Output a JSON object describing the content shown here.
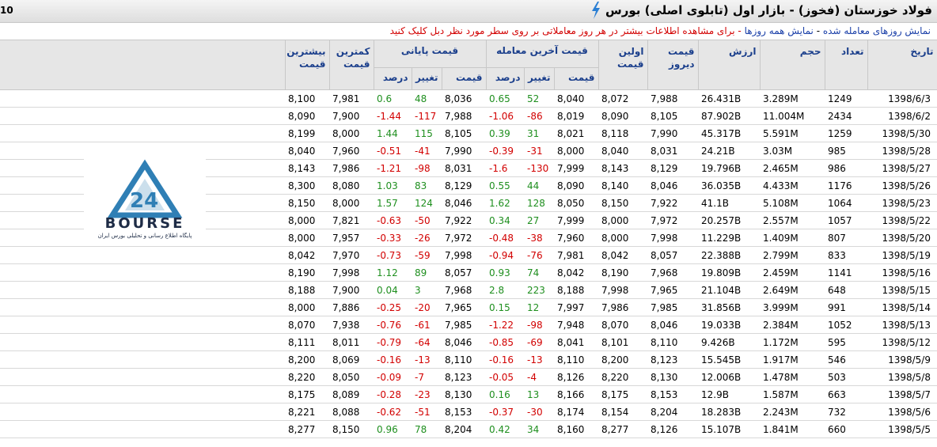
{
  "header": {
    "title": "فولاد خوزستان (فخوز) - بازار اول (تابلوی اصلی) بورس",
    "corner_text": "10"
  },
  "links": {
    "traded_days": "نمایش روزهای معامله شده",
    "separator": "-",
    "all_days": "نمایش همه روزها",
    "note": "- برای مشاهده اطلاعات بیشتر در هر روز معاملاتی بر روی سطر مورد نظر دبل کلیک کنید"
  },
  "logo": {
    "text": "BOURSE",
    "number": "24",
    "tagline": "پایگاه اطلاع رسانی و تحلیلی بورس ایران",
    "colors": {
      "accent": "#2f7fb5",
      "text": "#1e2c46"
    }
  },
  "colors": {
    "positive": "#1f8f1f",
    "negative": "#d20000",
    "header_text": "#1b3f8c"
  },
  "table": {
    "headers": {
      "date": "تاریخ",
      "count": "تعداد",
      "volume": "حجم",
      "value": "ارزش",
      "yesterday": "قیمت دیروز",
      "first": "اولین قیمت",
      "last_trade_group": "قیمت آخرین معامله",
      "final_group": "قیمت پایانی",
      "price": "قیمت",
      "change": "تغییر",
      "percent": "درصد",
      "low": "کمترین قیمت",
      "high": "بیشترین قیمت"
    },
    "rows": [
      {
        "date": "1398/6/3",
        "count": "1249",
        "volume": "3.289M",
        "value": "26.431B",
        "yesterday": "7,988",
        "first": "8,072",
        "last_price": "8,040",
        "last_change": "52",
        "last_pct": "0.65",
        "final_price": "8,036",
        "final_change": "48",
        "final_pct": "0.6",
        "low": "7,981",
        "high": "8,100"
      },
      {
        "date": "1398/6/2",
        "count": "2434",
        "volume": "11.004M",
        "value": "87.902B",
        "yesterday": "8,105",
        "first": "8,090",
        "last_price": "8,019",
        "last_change": "-86",
        "last_pct": "-1.06",
        "final_price": "7,988",
        "final_change": "-117",
        "final_pct": "-1.44",
        "low": "7,900",
        "high": "8,090"
      },
      {
        "date": "1398/5/30",
        "count": "1259",
        "volume": "5.591M",
        "value": "45.317B",
        "yesterday": "7,990",
        "first": "8,118",
        "last_price": "8,021",
        "last_change": "31",
        "last_pct": "0.39",
        "final_price": "8,105",
        "final_change": "115",
        "final_pct": "1.44",
        "low": "8,000",
        "high": "8,199"
      },
      {
        "date": "1398/5/28",
        "count": "985",
        "volume": "3.03M",
        "value": "24.21B",
        "yesterday": "8,031",
        "first": "8,040",
        "last_price": "8,000",
        "last_change": "-31",
        "last_pct": "-0.39",
        "final_price": "7,990",
        "final_change": "-41",
        "final_pct": "-0.51",
        "low": "7,960",
        "high": "8,040"
      },
      {
        "date": "1398/5/27",
        "count": "986",
        "volume": "2.465M",
        "value": "19.796B",
        "yesterday": "8,129",
        "first": "8,143",
        "last_price": "7,999",
        "last_change": "-130",
        "last_pct": "-1.6",
        "final_price": "8,031",
        "final_change": "-98",
        "final_pct": "-1.21",
        "low": "7,986",
        "high": "8,143"
      },
      {
        "date": "1398/5/26",
        "count": "1176",
        "volume": "4.433M",
        "value": "36.035B",
        "yesterday": "8,046",
        "first": "8,140",
        "last_price": "8,090",
        "last_change": "44",
        "last_pct": "0.55",
        "final_price": "8,129",
        "final_change": "83",
        "final_pct": "1.03",
        "low": "8,080",
        "high": "8,300"
      },
      {
        "date": "1398/5/23",
        "count": "1064",
        "volume": "5.108M",
        "value": "41.1B",
        "yesterday": "7,922",
        "first": "8,150",
        "last_price": "8,050",
        "last_change": "128",
        "last_pct": "1.62",
        "final_price": "8,046",
        "final_change": "124",
        "final_pct": "1.57",
        "low": "8,000",
        "high": "8,150"
      },
      {
        "date": "1398/5/22",
        "count": "1057",
        "volume": "2.557M",
        "value": "20.257B",
        "yesterday": "7,972",
        "first": "8,000",
        "last_price": "7,999",
        "last_change": "27",
        "last_pct": "0.34",
        "final_price": "7,922",
        "final_change": "-50",
        "final_pct": "-0.63",
        "low": "7,821",
        "high": "8,000"
      },
      {
        "date": "1398/5/20",
        "count": "807",
        "volume": "1.409M",
        "value": "11.229B",
        "yesterday": "7,998",
        "first": "8,000",
        "last_price": "7,960",
        "last_change": "-38",
        "last_pct": "-0.48",
        "final_price": "7,972",
        "final_change": "-26",
        "final_pct": "-0.33",
        "low": "7,957",
        "high": "8,000"
      },
      {
        "date": "1398/5/19",
        "count": "833",
        "volume": "2.799M",
        "value": "22.388B",
        "yesterday": "8,057",
        "first": "8,042",
        "last_price": "7,981",
        "last_change": "-76",
        "last_pct": "-0.94",
        "final_price": "7,998",
        "final_change": "-59",
        "final_pct": "-0.73",
        "low": "7,970",
        "high": "8,042"
      },
      {
        "date": "1398/5/16",
        "count": "1141",
        "volume": "2.459M",
        "value": "19.809B",
        "yesterday": "7,968",
        "first": "8,190",
        "last_price": "8,042",
        "last_change": "74",
        "last_pct": "0.93",
        "final_price": "8,057",
        "final_change": "89",
        "final_pct": "1.12",
        "low": "7,998",
        "high": "8,190"
      },
      {
        "date": "1398/5/15",
        "count": "648",
        "volume": "2.649M",
        "value": "21.104B",
        "yesterday": "7,965",
        "first": "7,998",
        "last_price": "8,188",
        "last_change": "223",
        "last_pct": "2.8",
        "final_price": "7,968",
        "final_change": "3",
        "final_pct": "0.04",
        "low": "7,900",
        "high": "8,188"
      },
      {
        "date": "1398/5/14",
        "count": "991",
        "volume": "3.999M",
        "value": "31.856B",
        "yesterday": "7,985",
        "first": "7,986",
        "last_price": "7,997",
        "last_change": "12",
        "last_pct": "0.15",
        "final_price": "7,965",
        "final_change": "-20",
        "final_pct": "-0.25",
        "low": "7,886",
        "high": "8,000"
      },
      {
        "date": "1398/5/13",
        "count": "1052",
        "volume": "2.384M",
        "value": "19.033B",
        "yesterday": "8,046",
        "first": "8,070",
        "last_price": "7,948",
        "last_change": "-98",
        "last_pct": "-1.22",
        "final_price": "7,985",
        "final_change": "-61",
        "final_pct": "-0.76",
        "low": "7,938",
        "high": "8,070"
      },
      {
        "date": "1398/5/12",
        "count": "595",
        "volume": "1.172M",
        "value": "9.426B",
        "yesterday": "8,110",
        "first": "8,101",
        "last_price": "8,041",
        "last_change": "-69",
        "last_pct": "-0.85",
        "final_price": "8,046",
        "final_change": "-64",
        "final_pct": "-0.79",
        "low": "8,011",
        "high": "8,111"
      },
      {
        "date": "1398/5/9",
        "count": "546",
        "volume": "1.917M",
        "value": "15.545B",
        "yesterday": "8,123",
        "first": "8,200",
        "last_price": "8,110",
        "last_change": "-13",
        "last_pct": "-0.16",
        "final_price": "8,110",
        "final_change": "-13",
        "final_pct": "-0.16",
        "low": "8,069",
        "high": "8,200"
      },
      {
        "date": "1398/5/8",
        "count": "503",
        "volume": "1.478M",
        "value": "12.006B",
        "yesterday": "8,130",
        "first": "8,220",
        "last_price": "8,126",
        "last_change": "-4",
        "last_pct": "-0.05",
        "final_price": "8,123",
        "final_change": "-7",
        "final_pct": "-0.09",
        "low": "8,050",
        "high": "8,220"
      },
      {
        "date": "1398/5/7",
        "count": "663",
        "volume": "1.587M",
        "value": "12.9B",
        "yesterday": "8,153",
        "first": "8,175",
        "last_price": "8,166",
        "last_change": "13",
        "last_pct": "0.16",
        "final_price": "8,130",
        "final_change": "-23",
        "final_pct": "-0.28",
        "low": "8,089",
        "high": "8,175"
      },
      {
        "date": "1398/5/6",
        "count": "732",
        "volume": "2.243M",
        "value": "18.283B",
        "yesterday": "8,204",
        "first": "8,154",
        "last_price": "8,174",
        "last_change": "-30",
        "last_pct": "-0.37",
        "final_price": "8,153",
        "final_change": "-51",
        "final_pct": "-0.62",
        "low": "8,088",
        "high": "8,221"
      },
      {
        "date": "1398/5/5",
        "count": "660",
        "volume": "1.841M",
        "value": "15.107B",
        "yesterday": "8,126",
        "first": "8,277",
        "last_price": "8,160",
        "last_change": "34",
        "last_pct": "0.42",
        "final_price": "8,204",
        "final_change": "78",
        "final_pct": "0.96",
        "low": "8,150",
        "high": "8,277"
      }
    ]
  }
}
